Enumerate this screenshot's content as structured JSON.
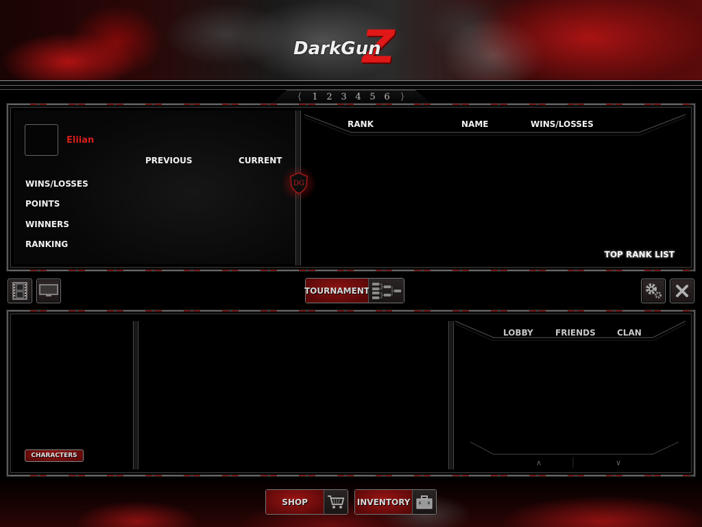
{
  "header": {
    "logo_text": "DarkGun",
    "logo_accent": "Z"
  },
  "pager": {
    "prev_icon": "chevron-left-icon",
    "pages": [
      "1",
      "2",
      "3",
      "4",
      "5",
      "6"
    ],
    "next_icon": "chevron-right-icon"
  },
  "profile": {
    "player_name": "Eliian",
    "columns": {
      "previous": "PREVIOUS",
      "current": "CURRENT"
    },
    "stats": [
      {
        "label": "WINS/LOSSES"
      },
      {
        "label": "POINTS"
      },
      {
        "label": "WINNERS"
      },
      {
        "label": "RANKING"
      }
    ],
    "badge": "DG"
  },
  "ranking": {
    "columns": {
      "rank": "RANK",
      "name": "NAME",
      "wins_losses": "WINS/LOSSES"
    },
    "rows": [],
    "top_rank_link": "TOP RANK LIST"
  },
  "toolbar": {
    "replay_icon": "film-icon",
    "screen_icon": "monitor-icon",
    "tournament_label": "TOURNAMENT",
    "tournament_icon": "bracket-icon",
    "settings_icon": "gear-icon",
    "close_icon": "close-icon"
  },
  "lower": {
    "characters_label": "CHARACTERS",
    "social_tabs": [
      "LOBBY",
      "FRIENDS",
      "CLAN"
    ],
    "scroll_up": "^",
    "scroll_down": "v"
  },
  "footer": {
    "shop_label": "SHOP",
    "inventory_label": "INVENTORY"
  },
  "colors": {
    "accent_red": "#d81e1e",
    "button_red": "#8a1414",
    "text_light": "#f2f2f2",
    "frame_gray": "#5a5a5a"
  }
}
